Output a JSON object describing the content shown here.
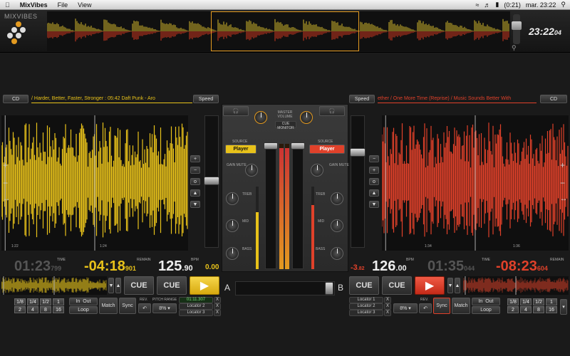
{
  "menubar": {
    "app": "MixVibes",
    "file": "File",
    "view": "View",
    "battery": "(0:21)",
    "datetime": "mar. 23:22"
  },
  "header": {
    "logo": "MIXVIBES",
    "clock": "23:22",
    "clock_sec": "04"
  },
  "left_deck": {
    "source_button": "CD",
    "track_title": "/ Harder, Better, Faster, Stronger : 05:42    Daft Punk - Aro",
    "speed_label": "Speed",
    "time_elapsed": "01:23",
    "time_elapsed_ms": "799",
    "time_label": "TIME",
    "remain_label": "REMAIN",
    "time_remain": "-04:18",
    "time_remain_ms": "901",
    "bpm_label": "BPM",
    "bpm": "125",
    "bpm_dec": "90",
    "pitch": "0.00",
    "tick_a": "1:22",
    "tick_b": "1:24",
    "cue1": "CUE",
    "cue2": "CUE",
    "loops_top": [
      "1/8",
      "1/4",
      "1/2",
      "1"
    ],
    "loops_bot": [
      "2",
      "4",
      "8",
      "16"
    ],
    "in_label": "In",
    "out_label": "Out",
    "loop_label": "Loop",
    "match_label": "Match",
    "sync_label": "Sync",
    "pitch_range_label": "PITCH RANGE",
    "pitch_range": "8%",
    "locator_time": "01:11.307",
    "locator2": "Locator 2",
    "locator3": "Locator 3",
    "x": "X",
    "rev_label": "REV."
  },
  "right_deck": {
    "source_button": "CD",
    "track_title": "ether / One More Time (Reprise) / Music Sounds Better With",
    "speed_label": "Speed",
    "pitch": "-3",
    "pitch_dec": "82",
    "bpm": "126",
    "bpm_dec": "00",
    "bpm_label": "BPM",
    "time_elapsed": "01:35",
    "time_elapsed_ms": "044",
    "time_label": "TIME",
    "remain_label": "REMAIN",
    "time_remain": "-08:23",
    "time_remain_ms": "604",
    "tick_a": "1:34",
    "tick_b": "1:36",
    "cue1": "CUE",
    "cue2": "CUE",
    "locator1": "Locator 1",
    "locator2": "Locator 2",
    "locator3": "Locator 3",
    "x": "X",
    "pitch_range": "8%",
    "sync_label": "Sync",
    "match_label": "Match",
    "in_label": "In",
    "out_label": "Out",
    "loop_label": "Loop",
    "loops_top": [
      "1/8",
      "1/4",
      "1/2",
      "1"
    ],
    "loops_bot": [
      "2",
      "4",
      "8",
      "16"
    ],
    "rev_label": "REV."
  },
  "mixer": {
    "master_volume": "MASTER VOLUME",
    "cue_monitor": "CUE MONITOR",
    "source_label": "SOURCE",
    "player_left": "Player",
    "player_right": "Player",
    "gain_label": "GAIN MUTE",
    "treb_label": "TREB",
    "mid_label": "MID",
    "bass_label": "BASS",
    "xfader_a": "A",
    "xfader_b": "B"
  },
  "colors": {
    "left_accent": "#e8c21a",
    "right_accent": "#e0412a",
    "orange": "#e39a20"
  }
}
